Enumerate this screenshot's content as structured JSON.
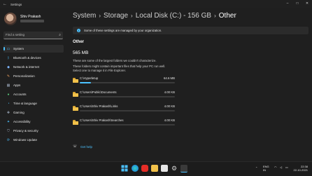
{
  "window": {
    "title": "Settings"
  },
  "profile": {
    "name": "Shiv Prakash"
  },
  "search": {
    "placeholder": "Find a setting"
  },
  "nav": [
    {
      "label": "System",
      "icon": "monitor-icon",
      "color": "#4cc2ff",
      "active": true
    },
    {
      "label": "Bluetooth & devices",
      "icon": "bluetooth-icon",
      "color": "#4cc2ff"
    },
    {
      "label": "Network & internet",
      "icon": "wifi-icon",
      "color": "#7fb6ff"
    },
    {
      "label": "Personalization",
      "icon": "brush-icon",
      "color": "#f3a35f"
    },
    {
      "label": "Apps",
      "icon": "apps-icon",
      "color": "#9aa6b8"
    },
    {
      "label": "Accounts",
      "icon": "person-icon",
      "color": "#57c479"
    },
    {
      "label": "Time & language",
      "icon": "globe-clock-icon",
      "color": "#4cc2ff"
    },
    {
      "label": "Gaming",
      "icon": "gamepad-icon",
      "color": "#9aa6b8"
    },
    {
      "label": "Accessibility",
      "icon": "accessibility-icon",
      "color": "#4cc2ff"
    },
    {
      "label": "Privacy & security",
      "icon": "shield-icon",
      "color": "#9aa6b8"
    },
    {
      "label": "Windows Update",
      "icon": "update-icon",
      "color": "#4cc2ff"
    }
  ],
  "breadcrumb": [
    "System",
    "Storage",
    "Local Disk (C:) - 156 GB",
    "Other"
  ],
  "banner": {
    "text": "Some of these settings are managed by your organization."
  },
  "section": {
    "title": "Other",
    "size": "565 MB",
    "desc1": "These are some of the largest folders we couldn't characterize.",
    "desc2": "These folders might contain important files that help your PC run well.",
    "desc3": "Select one to manage it in File Explorer."
  },
  "folders": [
    {
      "name": "C:\\Hyperletup",
      "size": "64.6 MB",
      "fill": 0.12
    },
    {
      "name": "C:\\Users\\Public\\Documents",
      "size": "4.00 KB",
      "fill": 0.0
    },
    {
      "name": "C:\\Users\\Shiv Prakash\\Links",
      "size": "4.00 KB",
      "fill": 0.0
    },
    {
      "name": "C:\\Users\\Shiv Prakash\\Searches",
      "size": "4.00 KB",
      "fill": 0.0
    }
  ],
  "help": {
    "label": "Get help"
  },
  "taskbar": {
    "lang1": "ENG",
    "lang2": "IN",
    "time": "22:38",
    "date": "22-10-2021"
  },
  "colors": {
    "accent": "#4cc2ff",
    "folder": "#f2c14a"
  }
}
